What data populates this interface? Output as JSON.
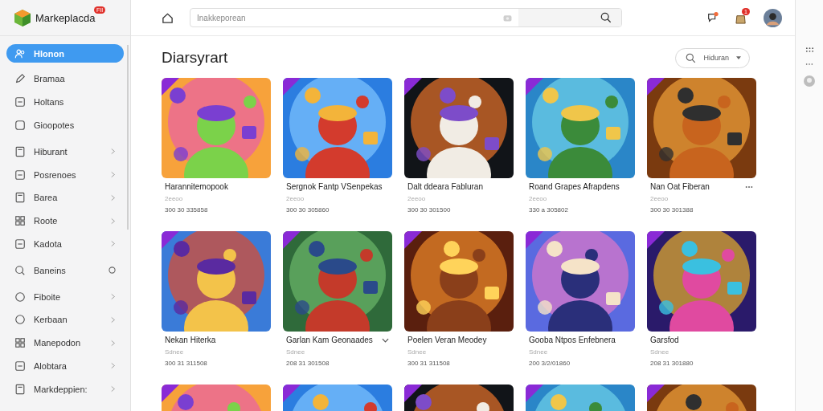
{
  "brand": {
    "name": "Markeplacda",
    "badge": "FII"
  },
  "search": {
    "placeholder": "Inakkeporean"
  },
  "header": {
    "bag_badge": "1"
  },
  "sidebar": {
    "items": [
      {
        "label": "Hlonon",
        "selected": true,
        "kind": "plain"
      },
      {
        "label": "Bramaa",
        "selected": false,
        "kind": "plain"
      },
      {
        "label": "Holtans",
        "selected": false,
        "kind": "plain"
      },
      {
        "label": "Gioopotes",
        "selected": false,
        "kind": "plain"
      },
      {
        "label": "Hiburant",
        "selected": false,
        "kind": "submenu"
      },
      {
        "label": "Posrenoes",
        "selected": false,
        "kind": "submenu"
      },
      {
        "label": "Barea",
        "selected": false,
        "kind": "submenu"
      },
      {
        "label": "Roote",
        "selected": false,
        "kind": "submenu"
      },
      {
        "label": "Kadota",
        "selected": false,
        "kind": "submenu"
      },
      {
        "label": "Baneins",
        "selected": false,
        "kind": "radio"
      },
      {
        "label": "Fiboite",
        "selected": false,
        "kind": "submenu"
      },
      {
        "label": "Kerbaan",
        "selected": false,
        "kind": "submenu"
      },
      {
        "label": "Manepodon",
        "selected": false,
        "kind": "submenu"
      },
      {
        "label": "Alobtara",
        "selected": false,
        "kind": "submenu"
      },
      {
        "label": "Markdeppien:",
        "selected": false,
        "kind": "submenu"
      }
    ]
  },
  "page": {
    "title": "Diarsyrart",
    "filter": "Hiduran"
  },
  "cards": [
    {
      "title": "Harannitemopook",
      "subtitle": "2eeoo",
      "meta": "300 30 335858",
      "kind": "plain"
    },
    {
      "title": "Sergnok Fantp VSenpekas",
      "subtitle": "2eeoo",
      "meta": "300 30 305860",
      "kind": "plain"
    },
    {
      "title": "Dalt ddeara Fabluran",
      "subtitle": "2eeoo",
      "meta": "300 30 301500",
      "kind": "plain"
    },
    {
      "title": "Roand Grapes Afrapdens",
      "subtitle": "2eeoo",
      "meta": "330 a 305802",
      "kind": "plain"
    },
    {
      "title": "Nan Oat Fiberan",
      "subtitle": "2eeoo",
      "meta": "300 30 301388",
      "kind": "menu"
    },
    {
      "title": "Nekan Hiterka",
      "subtitle": "Sdnee",
      "meta": "300 31 311508",
      "kind": "plain"
    },
    {
      "title": "Garlan Kam Geonaades",
      "subtitle": "Sdnee",
      "meta": "208 31 301508",
      "kind": "expand"
    },
    {
      "title": "Poelen Veran Meodey",
      "subtitle": "Sdnee",
      "meta": "300 31 311508",
      "kind": "plain"
    },
    {
      "title": "Gooba Ntpos Enfebnera",
      "subtitle": "Sdnee",
      "meta": "200 3/2/01860",
      "kind": "plain"
    },
    {
      "title": "Garsfod",
      "subtitle": "Sdnee",
      "meta": "208 31 301880",
      "kind": "plain"
    },
    {
      "kind": "picture"
    },
    {
      "kind": "picture"
    },
    {
      "kind": "picture"
    },
    {
      "kind": "picture"
    },
    {
      "kind": "picture"
    }
  ]
}
